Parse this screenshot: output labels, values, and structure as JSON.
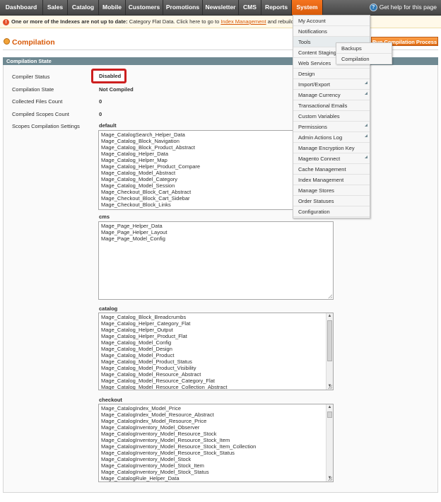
{
  "nav": {
    "items": [
      "Dashboard",
      "Sales",
      "Catalog",
      "Mobile",
      "Customers",
      "Promotions",
      "Newsletter",
      "CMS",
      "Reports",
      "System"
    ],
    "active": "System",
    "help_text": "Get help for this page"
  },
  "notice": {
    "bold": "One or more of the Indexes are not up to date:",
    "text": " Category Flat Data. Click here to go to ",
    "link": "Index Management",
    "tail": " and rebuild required indexes."
  },
  "page": {
    "title": "Compilation",
    "run_button": "Run Compilation Process"
  },
  "section": {
    "title": "Compilation State",
    "fields": [
      {
        "label": "Compiler Status",
        "value": "Disabled"
      },
      {
        "label": "Compilation State",
        "value": "Not Compiled"
      },
      {
        "label": "Collected Files Count",
        "value": "0"
      },
      {
        "label": "Compiled Scopes Count",
        "value": "0"
      },
      {
        "label": "Scopes Compilation Settings",
        "value": ""
      }
    ]
  },
  "scopes": [
    {
      "name": "default",
      "items": [
        "Mage_CatalogSearch_Helper_Data",
        "Mage_Catalog_Block_Navigation",
        "Mage_Catalog_Block_Product_Abstract",
        "Mage_Catalog_Helper_Data",
        "Mage_Catalog_Helper_Map",
        "Mage_Catalog_Helper_Product_Compare",
        "Mage_Catalog_Model_Abstract",
        "Mage_Catalog_Model_Category",
        "Mage_Catalog_Model_Session",
        "Mage_Checkout_Block_Cart_Abstract",
        "Mage_Checkout_Block_Cart_Sidebar",
        "Mage_Checkout_Block_Links"
      ]
    },
    {
      "name": "cms",
      "items": [
        "Mage_Page_Helper_Data",
        "Mage_Page_Helper_Layout",
        "Mage_Page_Model_Config"
      ]
    },
    {
      "name": "catalog",
      "items": [
        "Mage_Catalog_Block_Breadcrumbs",
        "Mage_Catalog_Helper_Category_Flat",
        "Mage_Catalog_Helper_Output",
        "Mage_Catalog_Helper_Product_Flat",
        "Mage_Catalog_Model_Config",
        "Mage_Catalog_Model_Design",
        "Mage_Catalog_Model_Product",
        "Mage_Catalog_Model_Product_Status",
        "Mage_Catalog_Model_Product_Visibility",
        "Mage_Catalog_Model_Resource_Abstract",
        "Mage_Catalog_Model_Resource_Category_Flat",
        "Mage_Catalog_Model_Resource_Collection_Abstract"
      ]
    },
    {
      "name": "checkout",
      "items": [
        "Mage_CatalogIndex_Model_Price",
        "Mage_CatalogIndex_Model_Resource_Abstract",
        "Mage_CatalogIndex_Model_Resource_Price",
        "Mage_CatalogInventory_Model_Observer",
        "Mage_CatalogInventory_Model_Resource_Stock",
        "Mage_CatalogInventory_Model_Resource_Stock_Item",
        "Mage_CatalogInventory_Model_Resource_Stock_Item_Collection",
        "Mage_CatalogInventory_Model_Resource_Stock_Status",
        "Mage_CatalogInventory_Model_Stock",
        "Mage_CatalogInventory_Model_Stock_Item",
        "Mage_CatalogInventory_Model_Stock_Status",
        "Mage_CatalogRule_Helper_Data"
      ]
    }
  ],
  "system_menu": {
    "items": [
      {
        "label": "My Account",
        "has_sub": false
      },
      {
        "label": "Notifications",
        "has_sub": false
      },
      {
        "label": "Tools",
        "has_sub": false
      },
      {
        "label": "Content Staging",
        "has_sub": false
      },
      {
        "label": "Web Services",
        "has_sub": true
      },
      {
        "label": "Design",
        "has_sub": false
      },
      {
        "label": "Import/Export",
        "has_sub": true
      },
      {
        "label": "Manage Currency",
        "has_sub": true
      },
      {
        "label": "Transactional Emails",
        "has_sub": false
      },
      {
        "label": "Custom Variables",
        "has_sub": false
      },
      {
        "label": "Permissions",
        "has_sub": true
      },
      {
        "label": "Admin Actions Log",
        "has_sub": true
      },
      {
        "label": "Manage Encryption Key",
        "has_sub": false
      },
      {
        "label": "Magento Connect",
        "has_sub": true
      },
      {
        "label": "Cache Management",
        "has_sub": false
      },
      {
        "label": "Index Management",
        "has_sub": false
      },
      {
        "label": "Manage Stores",
        "has_sub": false
      },
      {
        "label": "Order Statuses",
        "has_sub": false
      },
      {
        "label": "Configuration",
        "has_sub": false
      }
    ],
    "tools_submenu": [
      "Backups",
      "Compilation"
    ]
  },
  "colors": {
    "accent": "#d85a09",
    "section_header": "#6f8992",
    "highlight_box": "#cc1f1f"
  }
}
